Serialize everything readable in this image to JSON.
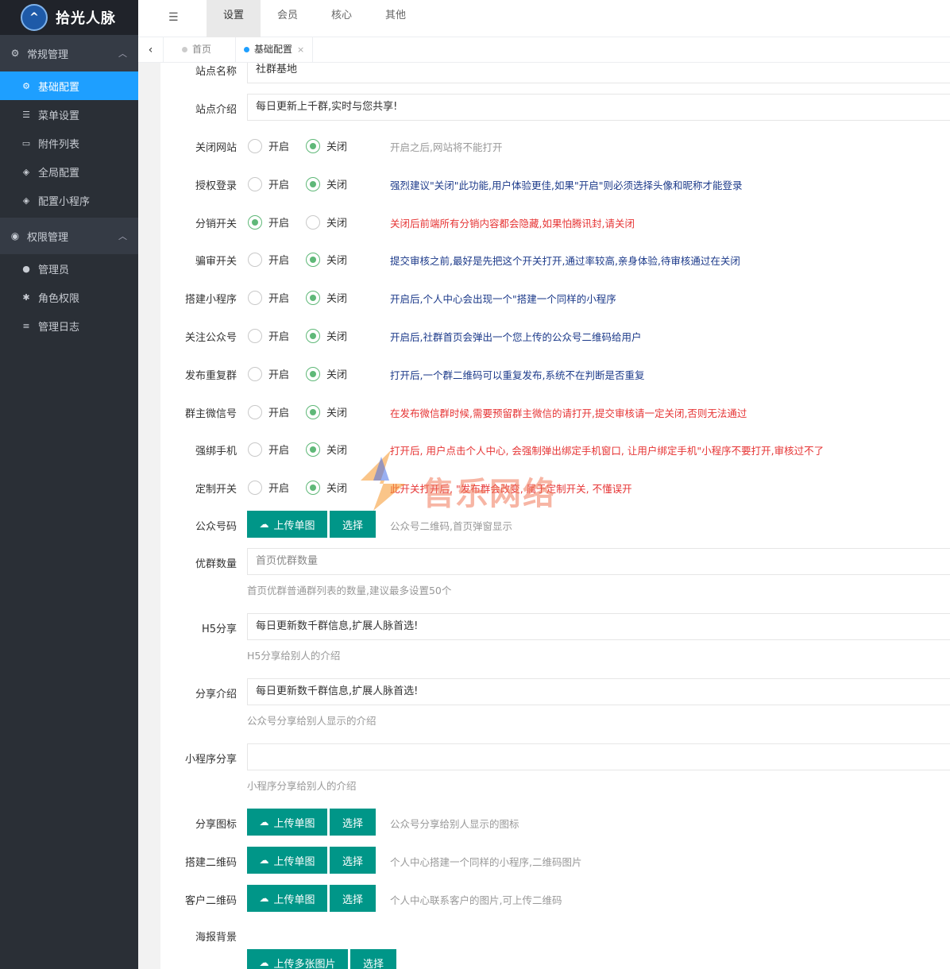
{
  "app": {
    "title": "拾光人脉",
    "logo_icon": "logo-icon"
  },
  "sidebar": {
    "groups": [
      {
        "label": "常规管理",
        "icon": "gear-icon",
        "items": [
          {
            "label": "基础配置",
            "icon": "gear-icon",
            "active": true
          },
          {
            "label": "菜单设置",
            "icon": "menu-icon"
          },
          {
            "label": "附件列表",
            "icon": "folder-icon"
          },
          {
            "label": "全局配置",
            "icon": "cube-icon"
          },
          {
            "label": "配置小程序",
            "icon": "cube-icon"
          }
        ]
      },
      {
        "label": "权限管理",
        "icon": "cat-icon",
        "items": [
          {
            "label": "管理员",
            "icon": "user-circle-icon"
          },
          {
            "label": "角色权限",
            "icon": "bug-icon"
          },
          {
            "label": "管理日志",
            "icon": "list-icon"
          }
        ]
      }
    ]
  },
  "topnav": {
    "tabs": [
      "设置",
      "会员",
      "核心",
      "其他"
    ],
    "active": "设置"
  },
  "pagetabs": {
    "home": "首页",
    "current": "基础配置"
  },
  "form": {
    "site_name": {
      "label": "站点名称",
      "value": "社群基地"
    },
    "site_intro": {
      "label": "站点介绍",
      "value": "每日更新上千群,实时与您共享!"
    },
    "radio_open": "开启",
    "radio_close": "关闭",
    "switches": [
      {
        "label": "关闭网站",
        "value": "off",
        "tip": "开启之后,网站将不能打开",
        "tip_color": "gray"
      },
      {
        "label": "授权登录",
        "value": "off",
        "tip": "强烈建议\"关闭\"此功能,用户体验更佳,如果\"开启\"则必须选择头像和昵称才能登录",
        "tip_color": "blue"
      },
      {
        "label": "分销开关",
        "value": "on",
        "tip": "关闭后前端所有分销内容都会隐藏,如果怕腾讯封,请关闭",
        "tip_color": "red"
      },
      {
        "label": "骗审开关",
        "value": "off",
        "tip": "提交审核之前,最好是先把这个开关打开,通过率较高,亲身体验,待审核通过在关闭",
        "tip_color": "blue"
      },
      {
        "label": "搭建小程序",
        "value": "off",
        "tip": "开启后,个人中心会出现一个\"搭建一个同样的小程序",
        "tip_color": "blue"
      },
      {
        "label": "关注公众号",
        "value": "off",
        "tip": "开启后,社群首页会弹出一个您上传的公众号二维码给用户",
        "tip_color": "blue"
      },
      {
        "label": "发布重复群",
        "value": "off",
        "tip": "打开后,一个群二维码可以重复发布,系统不在判断是否重复",
        "tip_color": "blue"
      },
      {
        "label": "群主微信号",
        "value": "off",
        "tip": "在发布微信群时候,需要预留群主微信的请打开,提交审核请一定关闭,否则无法通过",
        "tip_color": "red"
      },
      {
        "label": "强绑手机",
        "value": "off",
        "tip": "打开后, 用户点击个人中心, 会强制弹出绑定手机窗口, 让用户绑定手机\"小程序不要打开,审核过不了",
        "tip_color": "red"
      },
      {
        "label": "定制开关",
        "value": "off",
        "tip": "此开关打开后, \"发布群会改变, 属于定制开关, 不懂误开",
        "tip_color": "red"
      }
    ],
    "upload_label": "上传单图",
    "upload_multi_label": "上传多张图片",
    "select_label": "选择",
    "gzh_qrcode": {
      "label": "公众号码",
      "tip": "公众号二维码,首页弹窗显示"
    },
    "youqun_count": {
      "label": "优群数量",
      "placeholder": "首页优群数量",
      "hint": "首页优群普通群列表的数量,建议最多设置50个"
    },
    "h5_share": {
      "label": "H5分享",
      "value": "每日更新数千群信息,扩展人脉首选!",
      "hint": "H5分享给别人的介绍"
    },
    "share_intro": {
      "label": "分享介绍",
      "value": "每日更新数千群信息,扩展人脉首选!",
      "hint": "公众号分享给别人显示的介绍"
    },
    "mp_share": {
      "label": "小程序分享",
      "value": "",
      "hint": "小程序分享给别人的介绍"
    },
    "share_icon": {
      "label": "分享图标",
      "tip": "公众号分享给别人显示的图标"
    },
    "build_qrcode": {
      "label": "搭建二维码",
      "tip": "个人中心搭建一个同样的小程序,二维码图片"
    },
    "kefu_qrcode": {
      "label": "客户二维码",
      "tip": "个人中心联系客户的图片,可上传二维码"
    },
    "poster_bg": {
      "label": "海报背景"
    }
  },
  "watermark": {
    "text": "售乐网络"
  },
  "colors": {
    "primary": "#009688",
    "active_blue": "#1e9fff",
    "radio_green": "#5fb878",
    "sidebar_bg": "#2a2f36"
  }
}
